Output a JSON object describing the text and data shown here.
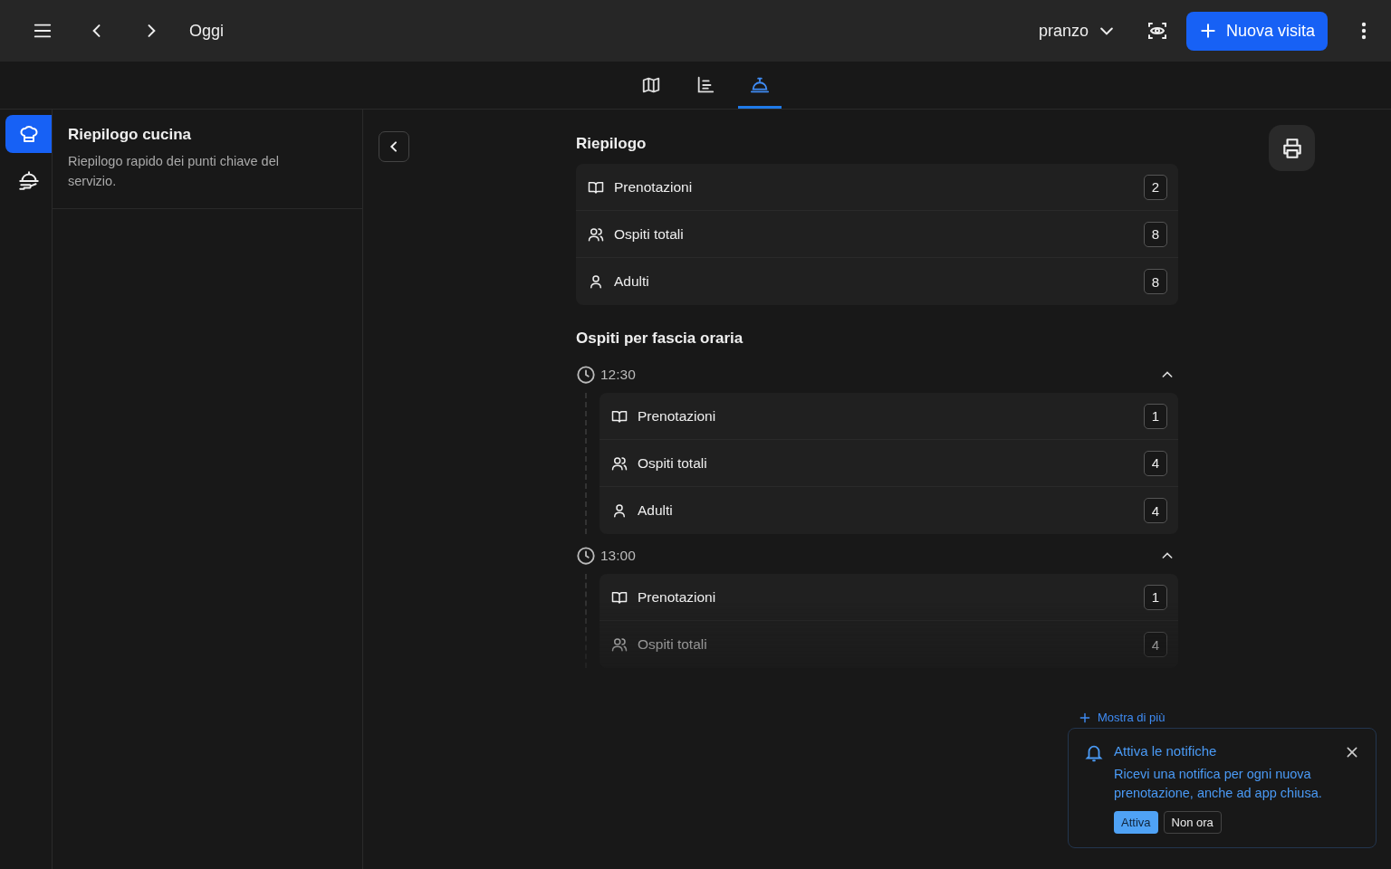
{
  "topbar": {
    "date_label": "Oggi",
    "service": "pranzo",
    "new_visit": "Nuova visita"
  },
  "view_tabs": [
    {
      "kind": "map",
      "selected": false
    },
    {
      "kind": "chart",
      "selected": false
    },
    {
      "kind": "bell",
      "selected": true
    }
  ],
  "rail": [
    {
      "kind": "chef",
      "selected": true
    },
    {
      "kind": "serving",
      "selected": false
    }
  ],
  "panel": {
    "title": "Riepilogo cucina",
    "description": "Riepilogo rapido dei punti chiave del servizio."
  },
  "summary": {
    "title": "Riepilogo",
    "rows": [
      {
        "kind": "book",
        "label": "Prenotazioni",
        "count": "2"
      },
      {
        "kind": "group",
        "label": "Ospiti totali",
        "count": "8"
      },
      {
        "kind": "person",
        "label": "Adulti",
        "count": "8"
      }
    ]
  },
  "slots_title": "Ospiti per fascia oraria",
  "slots": [
    {
      "time": "12:30",
      "expanded": true,
      "rows": [
        {
          "kind": "book",
          "label": "Prenotazioni",
          "count": "1"
        },
        {
          "kind": "group",
          "label": "Ospiti totali",
          "count": "4"
        },
        {
          "kind": "person",
          "label": "Adulti",
          "count": "4"
        }
      ]
    },
    {
      "time": "13:00",
      "expanded": true,
      "rows": [
        {
          "kind": "book",
          "label": "Prenotazioni",
          "count": "1"
        },
        {
          "kind": "group",
          "label": "Ospiti totali",
          "count": "4"
        }
      ]
    }
  ],
  "show_more": "Mostra di più",
  "notification": {
    "title": "Attiva le notifiche",
    "message": "Ricevi una notifica per ogni nuova prenotazione, anche ad app chiusa.",
    "primary": "Attiva",
    "secondary": "Non ora"
  }
}
